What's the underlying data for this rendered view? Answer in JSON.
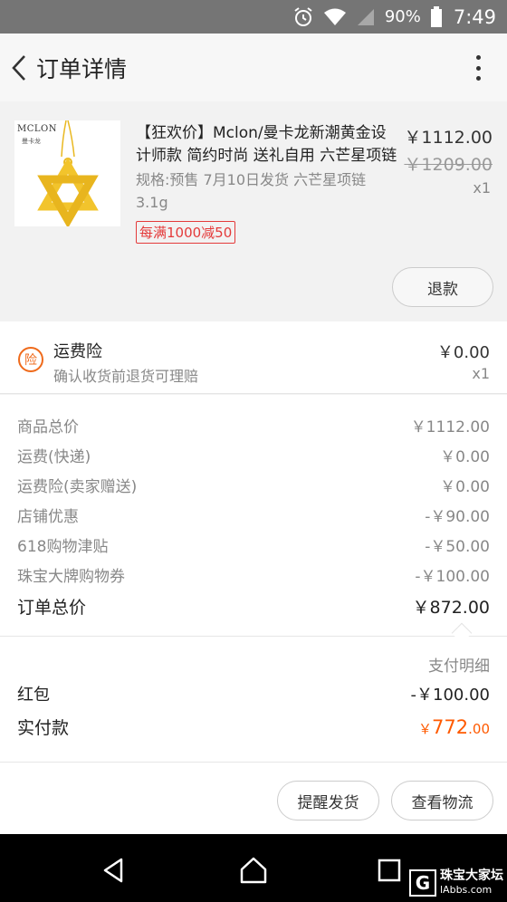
{
  "status_bar": {
    "battery": "90%",
    "time": "7:49"
  },
  "header": {
    "title": "订单详情"
  },
  "product": {
    "brand": "MCLON",
    "brand_cn": "曼卡龙",
    "title": "【狂欢价】Mclon/曼卡龙新潮黄金设计师款 简约时尚 送礼自用 六芒星项链3.1g",
    "spec": "规格:预售 7月10日发货  六芒星项链 3.1g",
    "promo": "每满1000减50",
    "price": "￥1112.00",
    "original_price": "￥1209.00",
    "quantity": "x1",
    "refund_label": "退款"
  },
  "insurance": {
    "icon_char": "险",
    "title": "运费险",
    "desc": "确认收货前退货可理赔",
    "price": "￥0.00",
    "quantity": "x1"
  },
  "summary": {
    "rows": [
      {
        "label": "商品总价",
        "value": "￥1112.00"
      },
      {
        "label": "运费(快递)",
        "value": "￥0.00"
      },
      {
        "label": "运费险(卖家赠送)",
        "value": "￥0.00"
      },
      {
        "label": "店铺优惠",
        "value": "-￥90.00"
      },
      {
        "label": "618购物津贴",
        "value": "-￥50.00"
      },
      {
        "label": "珠宝大牌购物券",
        "value": "-￥100.00"
      }
    ],
    "total_label": "订单总价",
    "total_value": "￥872.00"
  },
  "payment": {
    "detail_label": "支付明细",
    "redpacket_label": "红包",
    "redpacket_value": "-￥100.00",
    "actual_label": "实付款",
    "actual_currency": "￥",
    "actual_int": "772",
    "actual_dec": ".00"
  },
  "actions": {
    "remind_label": "提醒发货",
    "logistics_label": "查看物流"
  },
  "watermark": {
    "logo": "G",
    "line1": "珠宝大家坛",
    "line2": "lAbbs.com"
  },
  "colors": {
    "accent": "#ff5a00",
    "promo_red": "#e43a3a",
    "insurance_orange": "#ef6a1b",
    "status_bar": "#757575",
    "gold": "#f2c42c"
  }
}
